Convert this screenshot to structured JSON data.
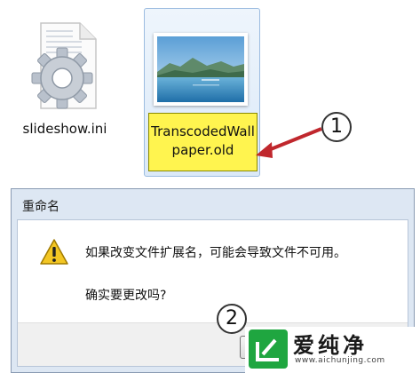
{
  "explorer": {
    "files": [
      {
        "name": "slideshow.ini",
        "icon": "settings-file-icon"
      },
      {
        "name_line1": "TranscodedWall",
        "name_line2": "paper.old",
        "icon": "image-thumbnail-icon",
        "state": "renaming"
      }
    ]
  },
  "callouts": {
    "first": "1",
    "second": "2"
  },
  "dialog": {
    "title": "重命名",
    "message": "如果改变文件扩展名，可能会导致文件不可用。",
    "question": "确实要更改吗?",
    "icon": "warning-icon"
  },
  "watermark": {
    "title": "爱纯净",
    "url": "www.aichunjing.com",
    "logo_color": "#1fa640"
  },
  "colors": {
    "rename_highlight": "#fff44f",
    "arrow": "#c0272d",
    "selection": "#dbe9f8"
  }
}
